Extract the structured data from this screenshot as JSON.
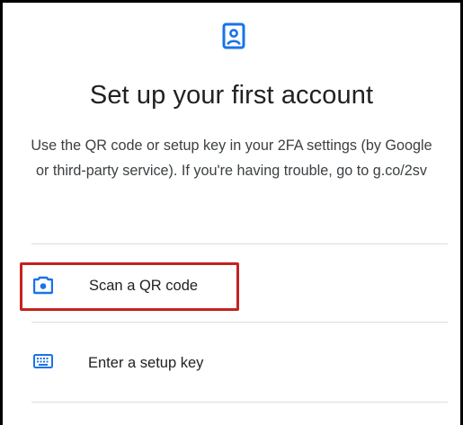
{
  "header": {
    "icon": "account-box-icon",
    "title": "Set up your first account",
    "description": "Use the QR code or setup key in your 2FA settings (by Google or third-party service). If you're having trouble, go to g.co/2sv"
  },
  "options": [
    {
      "icon": "camera-icon",
      "label": "Scan a QR code",
      "highlighted": true
    },
    {
      "icon": "keyboard-icon",
      "label": "Enter a setup key",
      "highlighted": false
    }
  ],
  "colors": {
    "accent": "#1a73e8",
    "highlight": "#c5221f",
    "text": "#202124",
    "secondary_text": "#3c4043",
    "divider": "#dadce0"
  }
}
